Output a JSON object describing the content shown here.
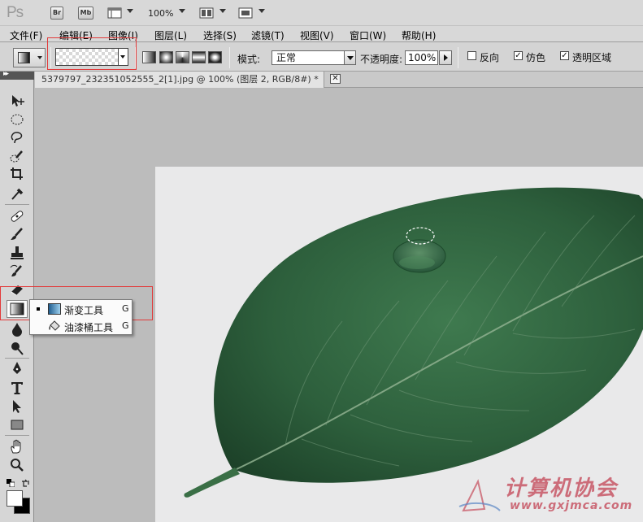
{
  "app": {
    "logo": "Ps",
    "bridge_label": "Br",
    "minibridge_label": "Mb",
    "zoom": "100%"
  },
  "menu": [
    {
      "label": "文件(F)"
    },
    {
      "label": "编辑(E)"
    },
    {
      "label": "图像(I)"
    },
    {
      "label": "图层(L)"
    },
    {
      "label": "选择(S)"
    },
    {
      "label": "滤镜(T)"
    },
    {
      "label": "视图(V)"
    },
    {
      "label": "窗口(W)"
    },
    {
      "label": "帮助(H)"
    }
  ],
  "options": {
    "mode_label": "模式:",
    "mode_value": "正常",
    "opacity_label": "不透明度:",
    "opacity_value": "100%",
    "reverse_label": "反向",
    "reverse_checked": false,
    "dither_label": "仿色",
    "dither_checked": true,
    "transparency_label": "透明区域",
    "transparency_checked": true
  },
  "document": {
    "tab_title": "5379797_232351052555_2[1].jpg @ 100% (图层 2, RGB/8#) *",
    "close_glyph": "✕"
  },
  "flyout": {
    "items": [
      {
        "label": "渐变工具",
        "shortcut": "G",
        "active": true
      },
      {
        "label": "油漆桶工具",
        "shortcut": "G",
        "active": false
      }
    ]
  },
  "watermark": {
    "title": "计算机协会",
    "url": "www.gxjmca.com"
  },
  "colors": {
    "highlight": "#e23a3a",
    "foreground": "#ffffff",
    "background": "#000000"
  }
}
